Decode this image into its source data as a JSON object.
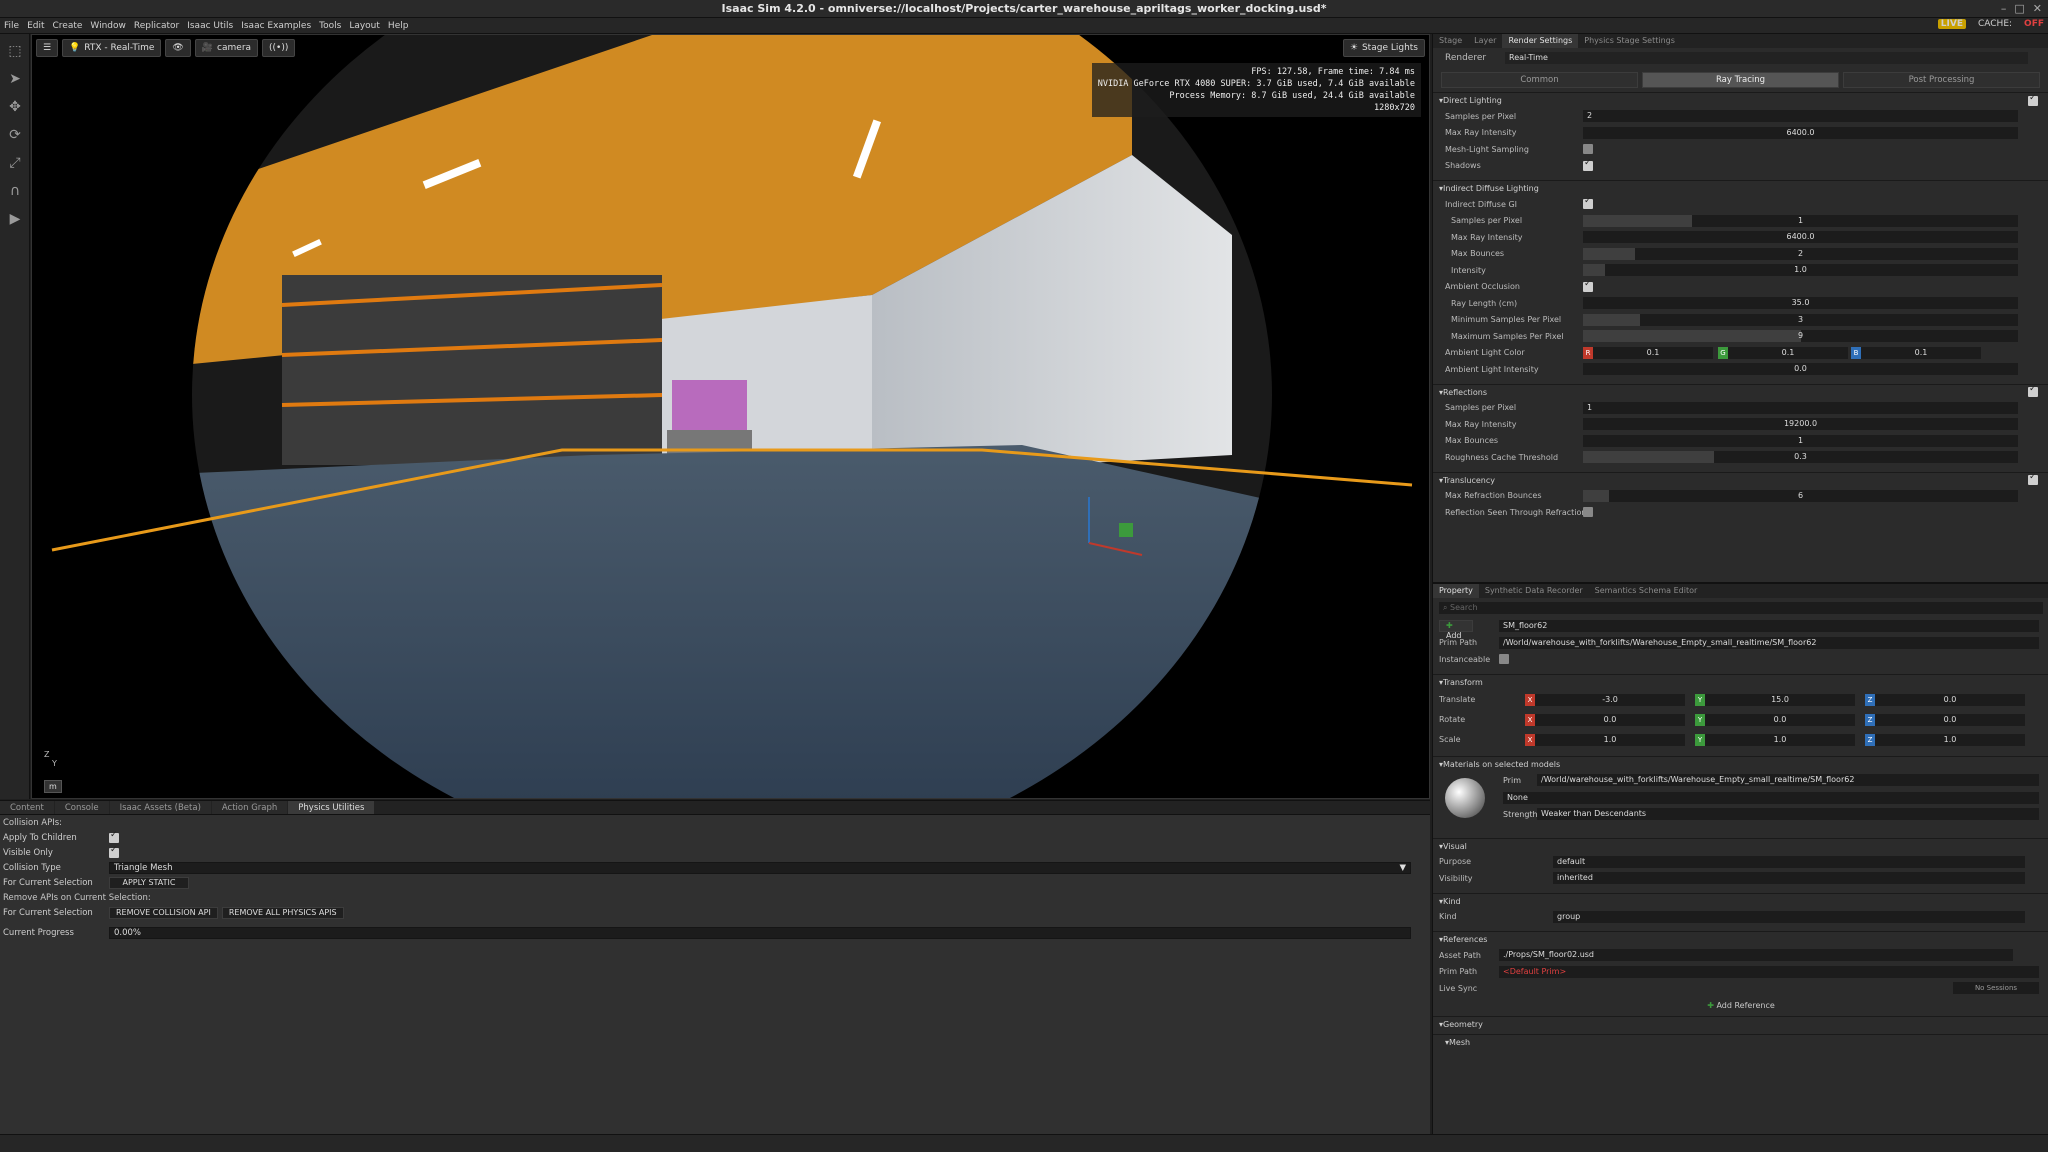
{
  "window": {
    "title": "Isaac Sim 4.2.0 - omniverse://localhost/Projects/carter_warehouse_apriltags_worker_docking.usd*"
  },
  "menu": [
    "File",
    "Edit",
    "Create",
    "Window",
    "Replicator",
    "Isaac Utils",
    "Isaac Examples",
    "Tools",
    "Layout",
    "Help"
  ],
  "status": {
    "live": "LIVE",
    "cache": "CACHE:",
    "cache_state": "OFF"
  },
  "viewport": {
    "renderer_btn": "RTX - Real-Time",
    "camera_btn": "camera",
    "stage_lights": "Stage Lights",
    "hud": [
      "FPS: 127.58, Frame time: 7.84 ms",
      "NVIDIA GeForce RTX 4080 SUPER: 3.7 GiB used, 7.4 GiB available",
      "Process Memory: 8.7 GiB used, 24.4 GiB available",
      "1280x720"
    ],
    "axis_z": "Z",
    "axis_y": "Y",
    "units": "m"
  },
  "bottom": {
    "tabs": [
      "Content",
      "Console",
      "Isaac Assets (Beta)",
      "Action Graph",
      "Physics Utilities"
    ],
    "collision_apis": "Collision APIs:",
    "apply_children": "Apply To Children",
    "visible_only": "Visible Only",
    "collision_type": "Collision Type",
    "collision_type_val": "Triangle Mesh",
    "for_current_selection": "For Current Selection",
    "apply_static": "APPLY STATIC",
    "remove_apis": "Remove APIs on Current Selection:",
    "remove_collision": "REMOVE COLLISION API",
    "remove_all": "REMOVE ALL PHYSICS APIS",
    "current_progress": "Current Progress",
    "progress_val": "0.00%",
    "progress": 0.0
  },
  "render": {
    "tabs": [
      "Stage",
      "Layer",
      "Render Settings",
      "Physics Stage Settings"
    ],
    "renderer_label": "Renderer",
    "renderer_val": "Real-Time",
    "modes": [
      "Common",
      "Ray Tracing",
      "Post Processing"
    ],
    "direct_lighting": "Direct Lighting",
    "dl_rows": [
      {
        "label": "Samples per Pixel",
        "val": "2"
      },
      {
        "label": "Max Ray Intensity",
        "val": "6400.0"
      },
      {
        "label": "Mesh-Light Sampling",
        "val": ""
      },
      {
        "label": "Shadows",
        "val": ""
      }
    ],
    "indirect": "Indirect Diffuse Lighting",
    "id_rows": [
      {
        "label": "Indirect Diffuse GI",
        "val": ""
      },
      {
        "label": "Samples per Pixel",
        "val": "1"
      },
      {
        "label": "Max Ray Intensity",
        "val": "6400.0"
      },
      {
        "label": "Max Bounces",
        "val": "2"
      },
      {
        "label": "Intensity",
        "val": "1.0"
      },
      {
        "label": "Ambient Occlusion",
        "val": ""
      },
      {
        "label": "Ray Length (cm)",
        "val": "35.0"
      },
      {
        "label": "Minimum Samples Per Pixel",
        "val": "3"
      },
      {
        "label": "Maximum Samples Per Pixel",
        "val": "9"
      }
    ],
    "ambient_color": "Ambient Light Color",
    "ambient_r": "0.1",
    "ambient_g": "0.1",
    "ambient_b": "0.1",
    "ambient_intensity": "Ambient Light Intensity",
    "ambient_intensity_val": "0.0",
    "reflections": "Reflections",
    "refl_rows": [
      {
        "label": "Samples per Pixel",
        "val": "1"
      },
      {
        "label": "Max Ray Intensity",
        "val": "19200.0"
      },
      {
        "label": "Max Bounces",
        "val": "1"
      },
      {
        "label": "Roughness Cache Threshold",
        "val": "0.3"
      }
    ],
    "translucency": "Translucency",
    "trans_rows": [
      {
        "label": "Max Refraction Bounces",
        "val": "6"
      },
      {
        "label": "Reflection Seen Through Refraction",
        "val": ""
      }
    ]
  },
  "property": {
    "tabs": [
      "Property",
      "Synthetic Data Recorder",
      "Semantics Schema Editor"
    ],
    "search": "Search",
    "add": "Add",
    "prim_name": "SM_floor62",
    "prim_path_label": "Prim Path",
    "prim_path": "/World/warehouse_with_forklifts/Warehouse_Empty_small_realtime/SM_floor62",
    "instanceable": "Instanceable",
    "transform": "Transform",
    "translate": "Translate",
    "rotate": "Rotate",
    "scale": "Scale",
    "t": [
      "-3.0",
      "15.0",
      "0.0"
    ],
    "r": [
      "0.0",
      "0.0",
      "0.0"
    ],
    "s": [
      "1.0",
      "1.0",
      "1.0"
    ],
    "materials": "Materials on selected models",
    "prim": "Prim",
    "mat_path": "/World/warehouse_with_forklifts/Warehouse_Empty_small_realtime/SM_floor62",
    "mat_none": "None",
    "strength": "Strength",
    "strength_val": "Weaker than Descendants",
    "visual": "Visual",
    "purpose": "Purpose",
    "purpose_val": "default",
    "visibility": "Visibility",
    "visibility_val": "inherited",
    "kind_sec": "Kind",
    "kind": "Kind",
    "kind_val": "group",
    "references": "References",
    "asset_path": "Asset Path",
    "asset_path_val": "./Props/SM_floor02.usd",
    "prim_path2": "Prim Path",
    "default_prim": "<Default Prim>",
    "live_sync": "Live Sync",
    "no_sessions": "No Sessions",
    "add_reference": "Add Reference",
    "geometry": "Geometry",
    "mesh": "Mesh"
  },
  "colors": {
    "accent_orange": "#e89a1a",
    "x_red": "#c0392b",
    "y_green": "#3c9a3c",
    "z_blue": "#2f6fb8"
  }
}
